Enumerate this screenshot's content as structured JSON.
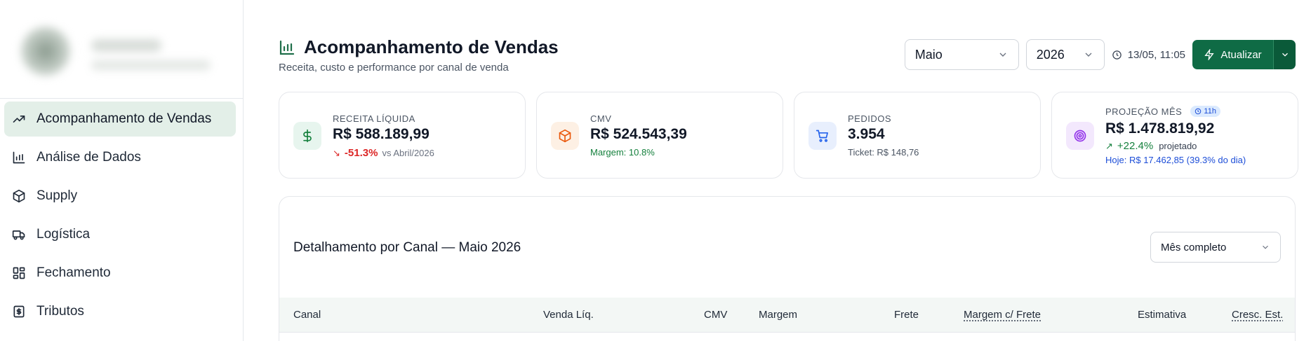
{
  "sidebar": {
    "items": [
      {
        "label": "Acompanhamento de Vendas",
        "icon": "trending-up-icon",
        "active": true
      },
      {
        "label": "Análise de Dados",
        "icon": "bar-chart-icon",
        "active": false
      },
      {
        "label": "Supply",
        "icon": "package-icon",
        "active": false
      },
      {
        "label": "Logística",
        "icon": "truck-icon",
        "active": false
      },
      {
        "label": "Fechamento",
        "icon": "grid-icon",
        "active": false
      },
      {
        "label": "Tributos",
        "icon": "receipt-icon",
        "active": false
      }
    ]
  },
  "header": {
    "title": "Acompanhamento de Vendas",
    "subtitle": "Receita, custo e performance por canal de venda",
    "month": "Maio",
    "year": "2026",
    "timestamp": "13/05, 11:05",
    "refresh_label": "Atualizar"
  },
  "kpis": {
    "receita": {
      "label": "RECEITA LÍQUIDA",
      "value": "R$ 588.189,99",
      "change": "-51.3%",
      "compare": "vs Abril/2026"
    },
    "cmv": {
      "label": "CMV",
      "value": "R$ 524.543,39",
      "margin": "Margem: 10.8%"
    },
    "pedidos": {
      "label": "PEDIDOS",
      "value": "3.954",
      "ticket": "Ticket: R$ 148,76"
    },
    "projecao": {
      "label": "PROJEÇÃO MÊS",
      "badge": "11h",
      "value": "R$ 1.478.819,92",
      "change": "+22.4%",
      "change_note": "projetado",
      "today": "Hoje: R$ 17.462,85 (39.3% do dia)"
    }
  },
  "panel": {
    "title": "Detalhamento por Canal — Maio 2026",
    "period": "Mês completo",
    "columns": [
      "Canal",
      "Venda Líq.",
      "CMV",
      "Margem",
      "Frete",
      "Margem c/ Frete",
      "Estimativa",
      "Cresc. Est."
    ]
  },
  "colors": {
    "accent": "#0f6b45",
    "negative": "#dc2626",
    "positive": "#15803d",
    "info": "#1d4ed8"
  }
}
